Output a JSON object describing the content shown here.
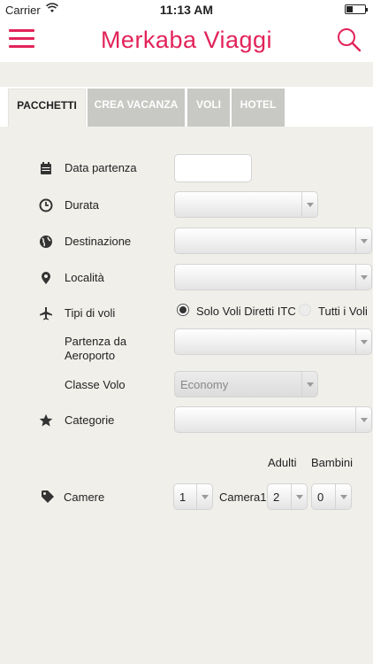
{
  "status_bar": {
    "carrier": "Carrier",
    "time": "11:13 AM",
    "battery_level": 0.35
  },
  "header": {
    "title": "Merkaba Viaggi",
    "menu_icon": "hamburger-icon",
    "search_icon": "search-icon"
  },
  "tabs": [
    {
      "label": "PACCHETTI",
      "active": true
    },
    {
      "label": "CREA VACANZA",
      "active": false
    },
    {
      "label": "VOLI",
      "active": false
    },
    {
      "label": "HOTEL",
      "active": false
    }
  ],
  "form": {
    "data_partenza": {
      "label": "Data partenza",
      "value": ""
    },
    "durata": {
      "label": "Durata",
      "value": ""
    },
    "destinazione": {
      "label": "Destinazione",
      "value": ""
    },
    "localita": {
      "label": "Località",
      "value": ""
    },
    "tipi_voli": {
      "label": "Tipi di voli",
      "options": [
        {
          "label": "Solo Voli Diretti ITC",
          "selected": true
        },
        {
          "label": "Tutti i Voli",
          "selected": false
        }
      ]
    },
    "partenza_aeroporto": {
      "label": "Partenza da Aeroporto",
      "value": ""
    },
    "classe_volo": {
      "label": "Classe Volo",
      "value": "Economy"
    },
    "categorie": {
      "label": "Categorie",
      "value": ""
    },
    "adulti_label": "Adulti",
    "bambini_label": "Bambini",
    "camere": {
      "label": "Camere",
      "value": "1",
      "camera_label": "Camera1",
      "adulti_value": "2",
      "bambini_value": "0"
    }
  },
  "colors": {
    "accent": "#e2235a",
    "background": "#f0efea",
    "tab_inactive": "#c8c8c5"
  }
}
